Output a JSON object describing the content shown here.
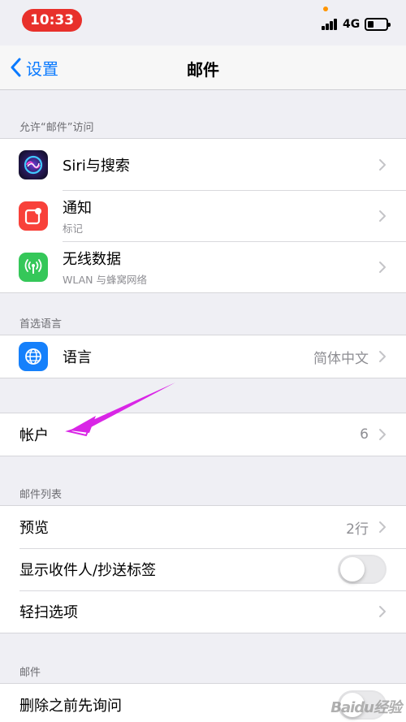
{
  "status_bar": {
    "time": "10:33",
    "network": "4G"
  },
  "nav": {
    "back_label": "设置",
    "title": "邮件"
  },
  "sections": {
    "allow_access": {
      "header": "允许“邮件”访问",
      "items": [
        {
          "label": "Siri与搜索",
          "icon": "siri-icon"
        },
        {
          "label": "通知",
          "sublabel": "标记",
          "icon": "notifications-icon",
          "color": "#f8413a"
        },
        {
          "label": "无线数据",
          "sublabel": "WLAN 与蜂窝网络",
          "icon": "antenna-icon",
          "color": "#35c759"
        }
      ]
    },
    "preferred_language": {
      "header": "首选语言",
      "items": [
        {
          "label": "语言",
          "value": "简体中文",
          "icon": "globe-icon",
          "color": "#1580fb"
        }
      ]
    },
    "accounts": {
      "items": [
        {
          "label": "帐户",
          "value": "6"
        }
      ]
    },
    "message_list": {
      "header": "邮件列表",
      "items": [
        {
          "label": "预览",
          "value": "2行"
        },
        {
          "label": "显示收件人/抄送标签",
          "toggle": false
        },
        {
          "label": "轻扫选项"
        }
      ]
    },
    "messages": {
      "header": "邮件",
      "items": [
        {
          "label": "删除之前先询问"
        }
      ]
    }
  },
  "annotation": {
    "arrow_color": "#d926e6"
  },
  "watermark": "Baidu经验"
}
